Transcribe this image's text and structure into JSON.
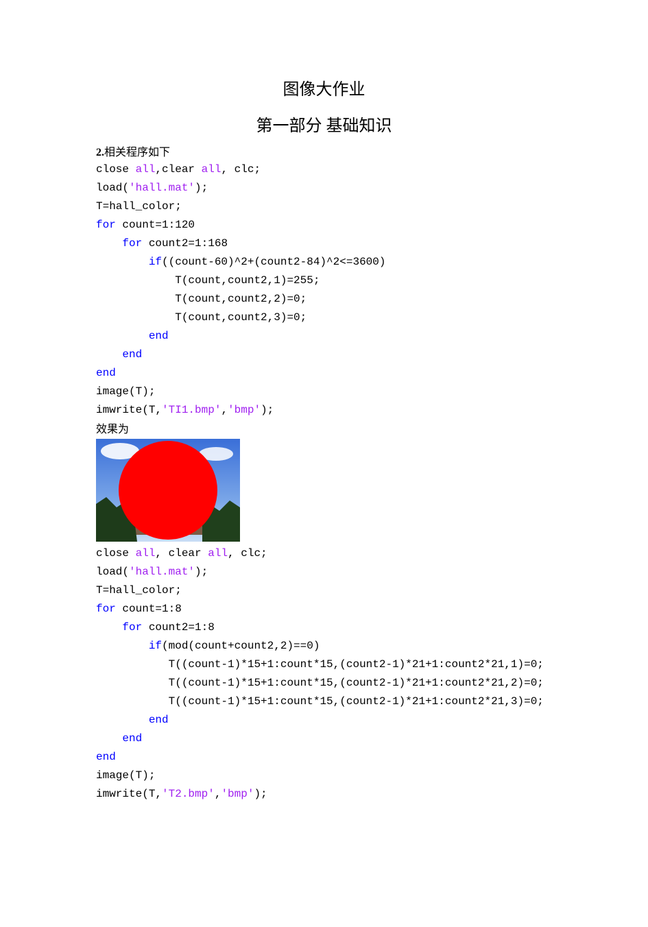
{
  "title_main": "图像大作业",
  "title_sub": "第一部分 基础知识",
  "intro_num": "2.",
  "intro_text": "相关程序如下",
  "c1": {
    "l1a": "close ",
    "l1b": "all",
    "l1c": ",clear ",
    "l1d": "all",
    "l1e": ", clc;",
    "l2a": "load(",
    "l2b": "'hall.mat'",
    "l2c": ");",
    "l3": "T=hall_color;",
    "l4a": "for",
    "l4b": " count=1:120",
    "l5a": "    ",
    "l5b": "for",
    "l5c": " count2=1:168",
    "l6a": "        ",
    "l6b": "if",
    "l6c": "((count-60)^2+(count2-84)^2<=3600)",
    "l7": "            T(count,count2,1)=255;",
    "l8": "            T(count,count2,2)=0;",
    "l9": "            T(count,count2,3)=0;",
    "l10a": "        ",
    "l10b": "end",
    "l11a": "    ",
    "l11b": "end",
    "l12": "end",
    "l13": "image(T);",
    "l14a": "imwrite(T,",
    "l14b": "'TI1.bmp'",
    "l14c": ",",
    "l14d": "'bmp'",
    "l14e": ");"
  },
  "result_label": "效果为",
  "c2": {
    "l1a": "close ",
    "l1b": "all",
    "l1c": ", clear ",
    "l1d": "all",
    "l1e": ", clc;",
    "l2a": "load(",
    "l2b": "'hall.mat'",
    "l2c": ");",
    "l3": "T=hall_color;",
    "l4a": "for",
    "l4b": " count=1:8",
    "l5a": "    ",
    "l5b": "for",
    "l5c": " count2=1:8",
    "l6a": "        ",
    "l6b": "if",
    "l6c": "(mod(count+count2,2)==0)",
    "l7": "           T((count-1)*15+1:count*15,(count2-1)*21+1:count2*21,1)=0;",
    "l8": "           T((count-1)*15+1:count*15,(count2-1)*21+1:count2*21,2)=0;",
    "l9": "           T((count-1)*15+1:count*15,(count2-1)*21+1:count2*21,3)=0;",
    "l10a": "        ",
    "l10b": "end",
    "l11a": "    ",
    "l11b": "end",
    "l12": "end",
    "l13": "image(T);",
    "l14a": "imwrite(T,",
    "l14b": "'T2.bmp'",
    "l14c": ",",
    "l14d": "'bmp'",
    "l14e": ");"
  }
}
